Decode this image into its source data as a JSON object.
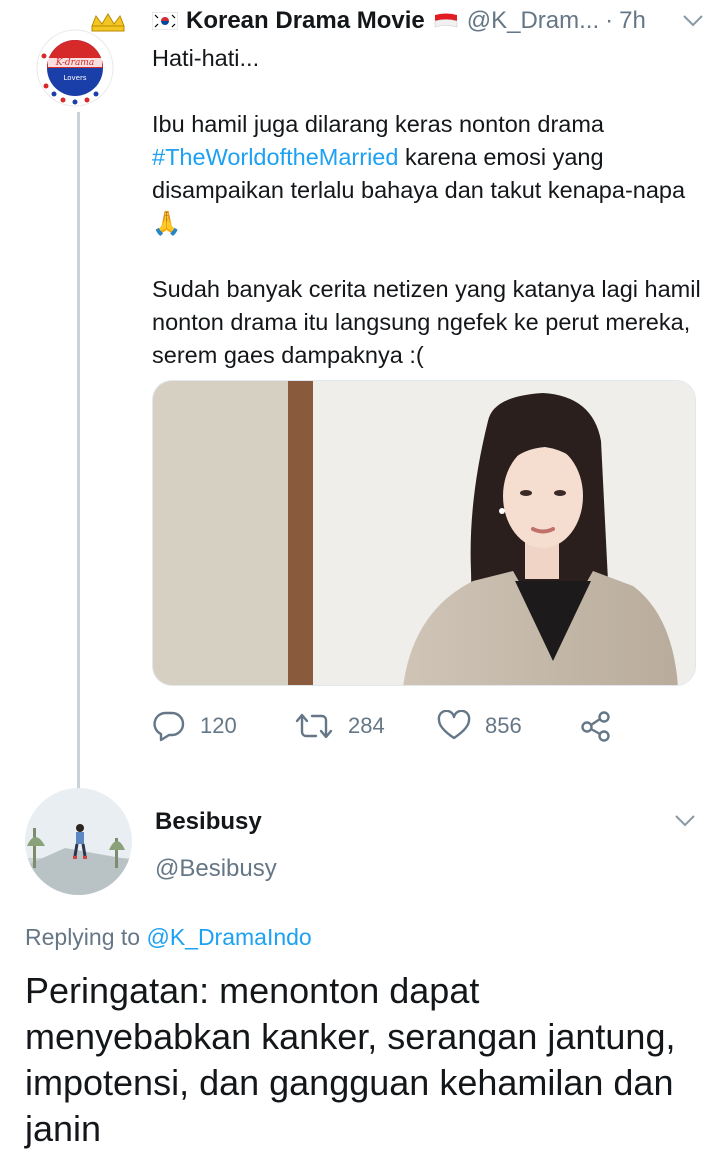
{
  "tweet": {
    "author_name": "Korean Drama Movie",
    "author_handle": "@K_Dram...",
    "separator": "·",
    "time": "7h",
    "avatar_text": "K-drama",
    "avatar_subtext": "Lovers",
    "text_line1": "Hati-hati...",
    "text_p2_before": "Ibu hamil juga dilarang keras nonton drama ",
    "hashtag": "#TheWorldoftheMarried",
    "text_p2_after": " karena emosi yang disampaikan terlalu bahaya dan takut kenapa-napa 🙏",
    "text_p3": "Sudah banyak cerita netizen yang katanya lagi hamil nonton drama itu langsung ngefek ke perut mereka, serem gaes dampaknya :(",
    "counts": {
      "replies": "120",
      "retweets": "284",
      "likes": "856"
    }
  },
  "reply": {
    "author_name": "Besibusy",
    "author_handle": "@Besibusy",
    "replying_prefix": "Replying to ",
    "replying_mention": "@K_DramaIndo",
    "text": "Peringatan: menonton dapat menyebabkan kanker, serangan jantung, impotensi,  dan gangguan kehamilan dan janin"
  },
  "icons": {
    "reply": "reply-icon",
    "retweet": "retweet-icon",
    "like": "heart-icon",
    "share": "share-icon",
    "more": "chevron-down-icon"
  },
  "colors": {
    "link": "#1da1f2",
    "secondary_text": "#657786",
    "thread_line": "#c9d3da"
  }
}
